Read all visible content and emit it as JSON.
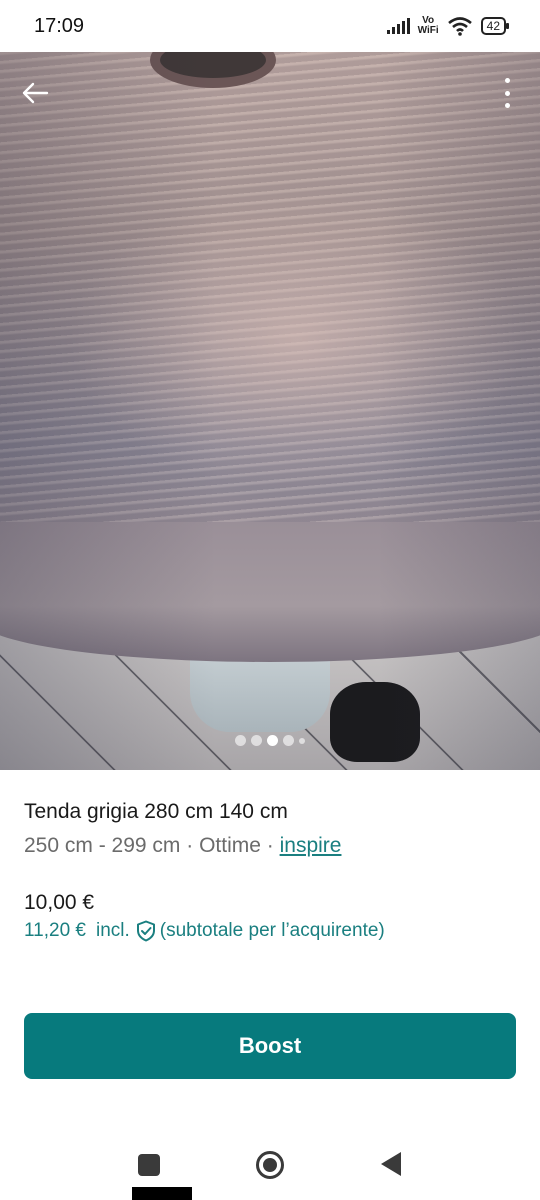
{
  "status_bar": {
    "time": "17:09",
    "network_label_top": "Vo",
    "network_label_bottom": "WiFi",
    "battery": "42"
  },
  "photo": {
    "carousel_count": 5,
    "carousel_active_index": 2
  },
  "item": {
    "title": "Tenda grigia 280 cm 140 cm",
    "size": "250 cm - 299 cm",
    "separator": " · ",
    "condition": "Ottime",
    "brand": "inspire",
    "price": "10,00 €",
    "buyer_price": "11,20 €",
    "buyer_price_incl": "incl.",
    "buyer_price_note": "(subtotale per l’acquirente)"
  },
  "actions": {
    "boost_label": "Boost"
  },
  "colors": {
    "accent": "#077a7d",
    "link": "#1a7f80"
  },
  "icons": {
    "back": "arrow-left-icon",
    "more": "more-vertical-icon",
    "shield": "shield-check-icon",
    "nav_recents": "square-icon",
    "nav_home": "circle-icon",
    "nav_back": "triangle-back-icon"
  }
}
